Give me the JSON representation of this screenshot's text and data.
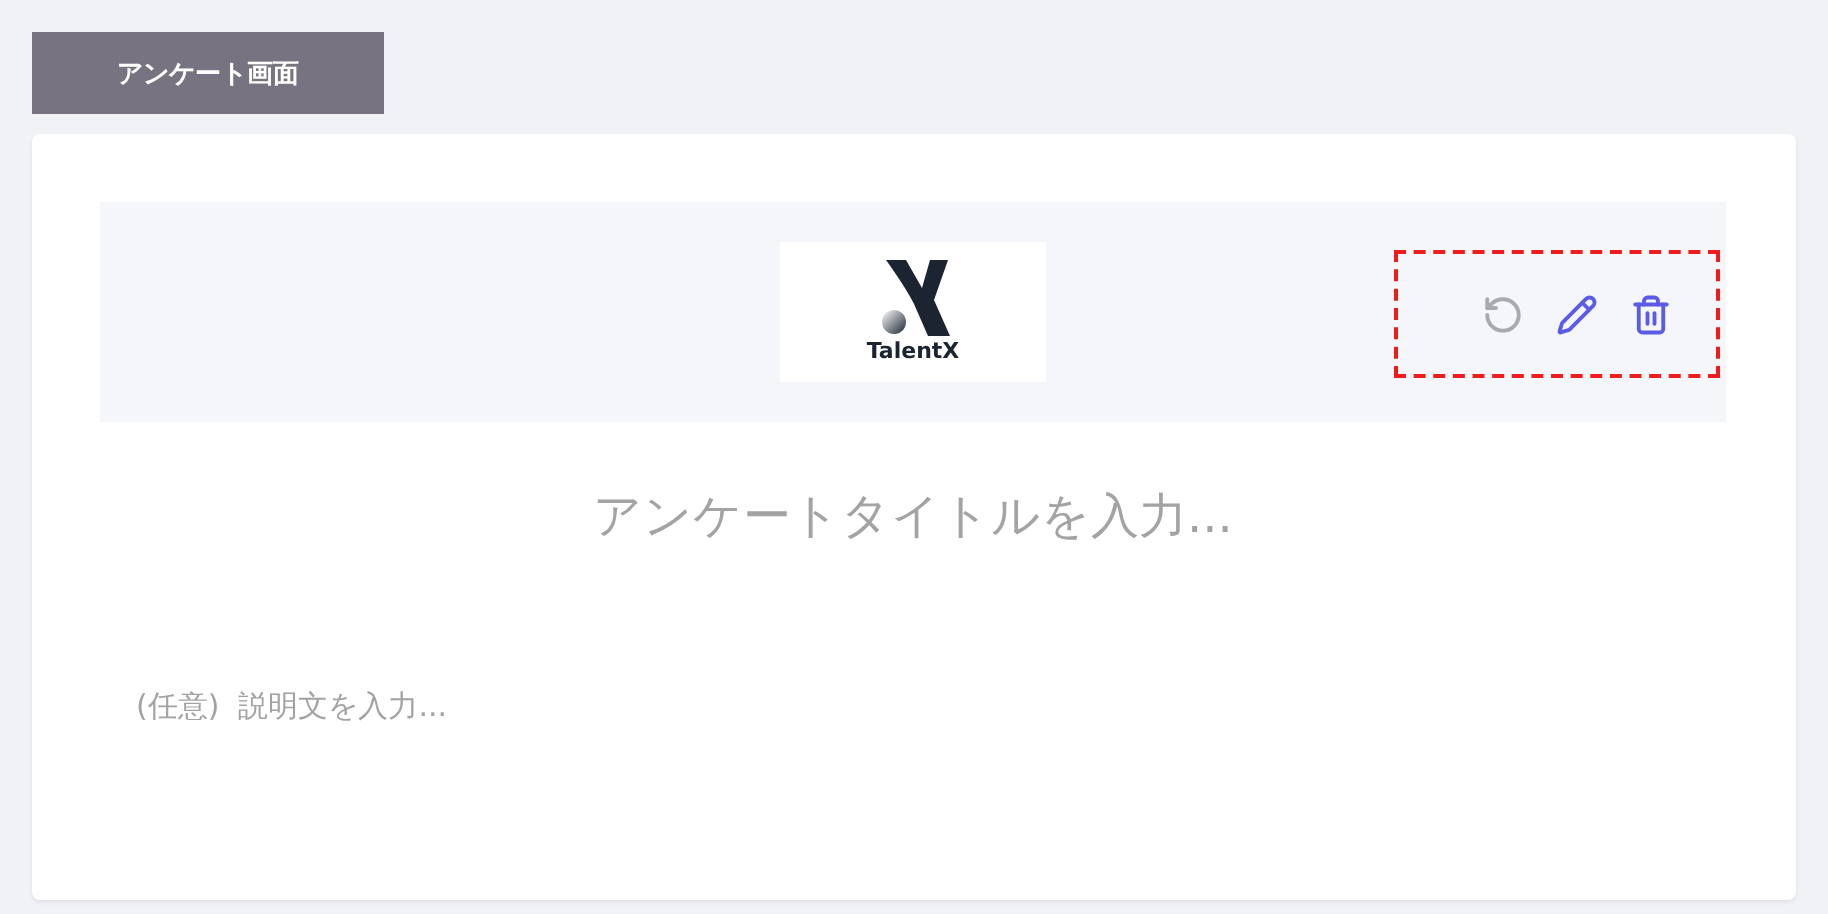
{
  "tab": {
    "label": "アンケート画面",
    "selected": true
  },
  "header": {
    "logo": {
      "text": "TalentX"
    },
    "highlighted": true,
    "actions": [
      {
        "kind": "reset",
        "disabled": true
      },
      {
        "kind": "edit",
        "disabled": false
      },
      {
        "kind": "delete",
        "disabled": false
      }
    ]
  },
  "title_field": {
    "placeholder": "アンケートタイトルを入力..."
  },
  "description_field": {
    "placeholder": "(任意)  説明文を入力..."
  }
}
